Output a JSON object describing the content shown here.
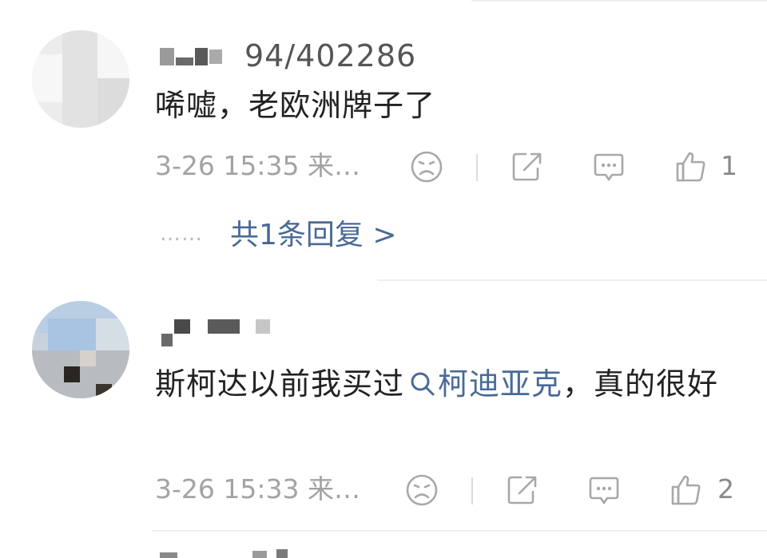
{
  "comments": [
    {
      "username": "94/402286",
      "text": "唏嘘，老欧洲牌子了",
      "time": "3-26 15:35 来…",
      "like_count": "1",
      "reply_link": "共1条回复 >",
      "reply_dots": "……"
    },
    {
      "text_before": "斯柯达以前我买过",
      "mention": "柯迪亚克",
      "text_after": "，真的很好",
      "time": "3-26 15:33 来…",
      "like_count": "2"
    }
  ],
  "icons": {
    "dislike": "sad-face-icon",
    "share": "share-icon",
    "reply": "comment-bubble-icon",
    "like": "thumbs-up-icon",
    "mention": "search-icon"
  },
  "colors": {
    "link": "#4a6a96",
    "meta_text": "#a3a3a3",
    "body_text": "#222222"
  }
}
